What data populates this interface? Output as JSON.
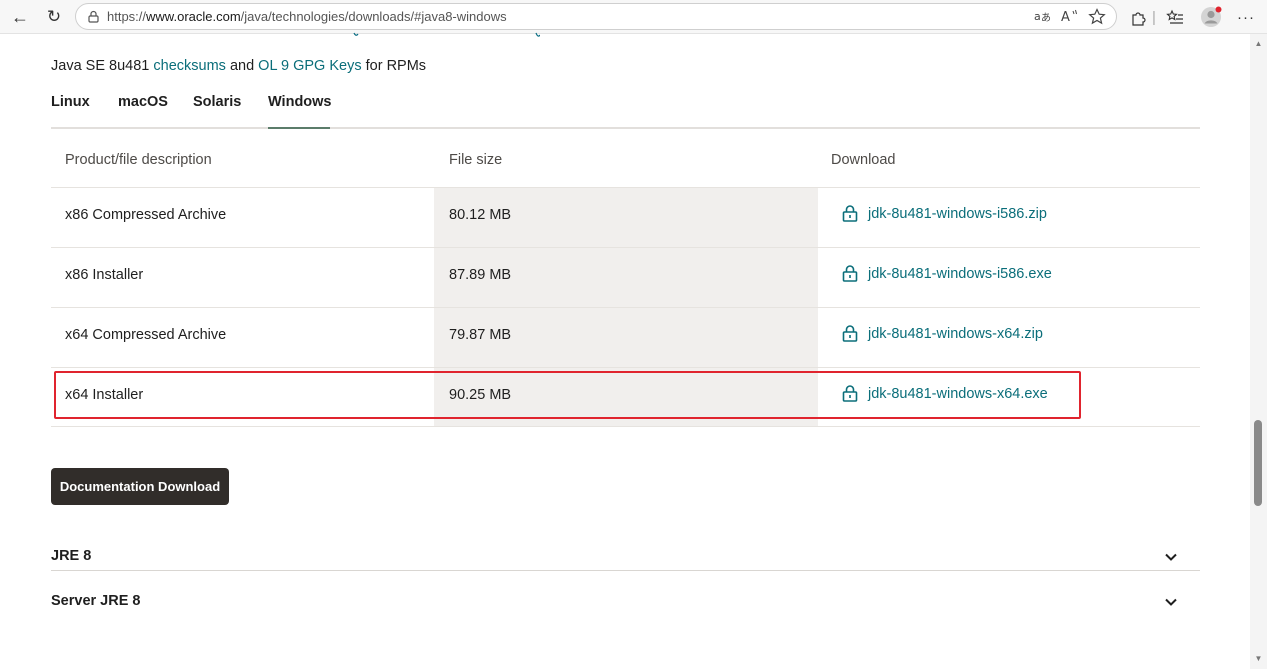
{
  "browser": {
    "url_prefix": "https://",
    "url_domain": "www.oracle.com",
    "url_path": "/java/technologies/downloads/#java8-windows",
    "notification_dot_color": "#e0242e"
  },
  "intro": {
    "prefix": "Java SE 8u481 ",
    "checksums_link": "checksums",
    "middle": " and ",
    "gpg_link": "OL 9 GPG Keys",
    "suffix": " for RPMs"
  },
  "tabs": [
    {
      "label": "Linux",
      "active": false
    },
    {
      "label": "macOS",
      "active": false
    },
    {
      "label": "Solaris",
      "active": false
    },
    {
      "label": "Windows",
      "active": true
    }
  ],
  "table": {
    "headers": [
      "Product/file description",
      "File size",
      "Download"
    ],
    "rows": [
      {
        "description": "x86 Compressed Archive",
        "size": "80.12 MB",
        "file": "jdk-8u481-windows-i586.zip"
      },
      {
        "description": "x86 Installer",
        "size": "87.89 MB",
        "file": "jdk-8u481-windows-i586.exe"
      },
      {
        "description": "x64 Compressed Archive",
        "size": "79.87 MB",
        "file": "jdk-8u481-windows-x64.zip"
      },
      {
        "description": "x64 Installer",
        "size": "90.25 MB",
        "file": "jdk-8u481-windows-x64.exe",
        "highlighted": true
      }
    ]
  },
  "documentation_button": "Documentation Download",
  "sections": [
    {
      "title": "JRE 8"
    },
    {
      "title": "Server JRE 8"
    }
  ],
  "colors": {
    "link": "#0b6e7a",
    "button_bg": "#312d2a",
    "highlight": "#e0242e",
    "tab_underline": "#5b7c6a"
  }
}
